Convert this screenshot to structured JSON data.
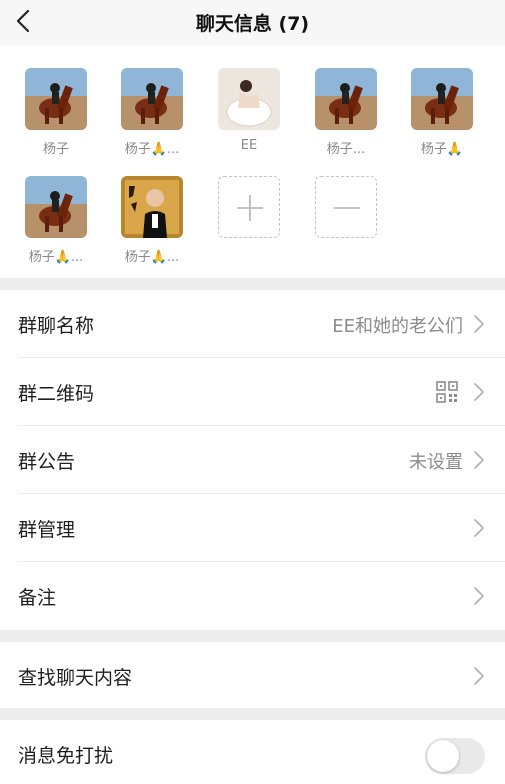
{
  "header": {
    "title": "聊天信息 (7)"
  },
  "members": [
    {
      "name": "杨子",
      "avatar": "horse-rider"
    },
    {
      "name": "杨子🙏...",
      "avatar": "horse-rider"
    },
    {
      "name": "EE",
      "avatar": "woman-portrait"
    },
    {
      "name": "杨子...",
      "avatar": "horse-rider"
    },
    {
      "name": "杨子🙏",
      "avatar": "horse-rider"
    },
    {
      "name": "杨子🙏...",
      "avatar": "horse-rider"
    },
    {
      "name": "杨子🙏...",
      "avatar": "man-portrait"
    }
  ],
  "member_actions": {
    "add": "plus-icon",
    "remove": "minus-icon"
  },
  "settings": {
    "group_name": {
      "label": "群聊名称",
      "value": "EE和她的老公们"
    },
    "qr_code": {
      "label": "群二维码"
    },
    "announcement": {
      "label": "群公告",
      "value": "未设置"
    },
    "management": {
      "label": "群管理"
    },
    "remark": {
      "label": "备注"
    },
    "search_history": {
      "label": "查找聊天内容"
    },
    "mute": {
      "label": "消息免打扰",
      "enabled": false
    }
  },
  "colors": {
    "background": "#ededed",
    "card": "#ffffff",
    "secondary_text": "#8c8c8c"
  }
}
